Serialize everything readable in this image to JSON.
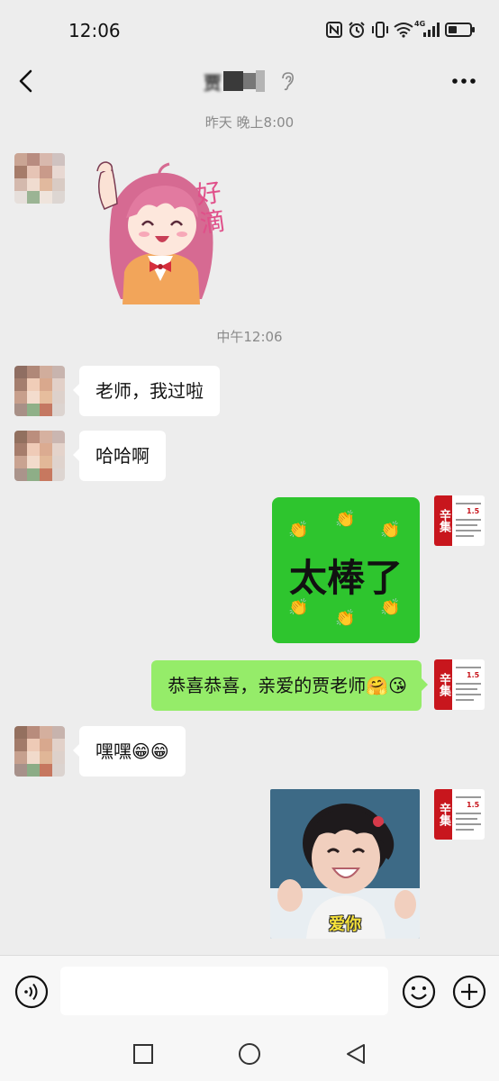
{
  "status_bar": {
    "time": "12:06",
    "icons": [
      "nfc-icon",
      "alarm-icon",
      "vibrate-icon",
      "wifi-icon",
      "signal-4g-icon",
      "battery-icon"
    ],
    "network_label": "4G"
  },
  "header": {
    "title": "贾",
    "icons": [
      "back-icon",
      "ear-icon",
      "more-icon"
    ]
  },
  "messages": [
    {
      "type": "time",
      "text": "昨天 晚上8:00"
    },
    {
      "type": "sticker",
      "side": "left",
      "sticker_text": "好滴",
      "icon": "anime-girl-sticker"
    },
    {
      "type": "time",
      "text": "中午12:06"
    },
    {
      "type": "text",
      "side": "left",
      "text": "老师，我过啦"
    },
    {
      "type": "text",
      "side": "left",
      "text": "哈哈啊"
    },
    {
      "type": "sticker",
      "side": "right",
      "sticker_text": "太棒了",
      "icon": "clapping-hands-sticker"
    },
    {
      "type": "text",
      "side": "right",
      "text": "恭喜恭喜，亲爱的贾老师",
      "emoji": "🤗😘"
    },
    {
      "type": "text",
      "side": "left",
      "text": "嘿嘿",
      "emoji": "😁😁"
    },
    {
      "type": "sticker",
      "side": "right",
      "sticker_text": "爱你",
      "icon": "smiling-girl-photo-sticker"
    }
  ],
  "my_avatar": {
    "title_chars": "辛集",
    "highlight_number": "1.5",
    "brand_color": "#c8161d"
  },
  "input_bar": {
    "icons": [
      "voice-icon",
      "emoji-icon",
      "plus-icon"
    ],
    "value": "",
    "placeholder": ""
  },
  "nav_bar": {
    "icons": [
      "recent-apps-icon",
      "home-icon",
      "back-nav-icon"
    ]
  },
  "colors": {
    "background": "#ededed",
    "sent_bubble": "#95ec69",
    "received_bubble": "#ffffff",
    "sticker_green": "#2ec52e"
  }
}
